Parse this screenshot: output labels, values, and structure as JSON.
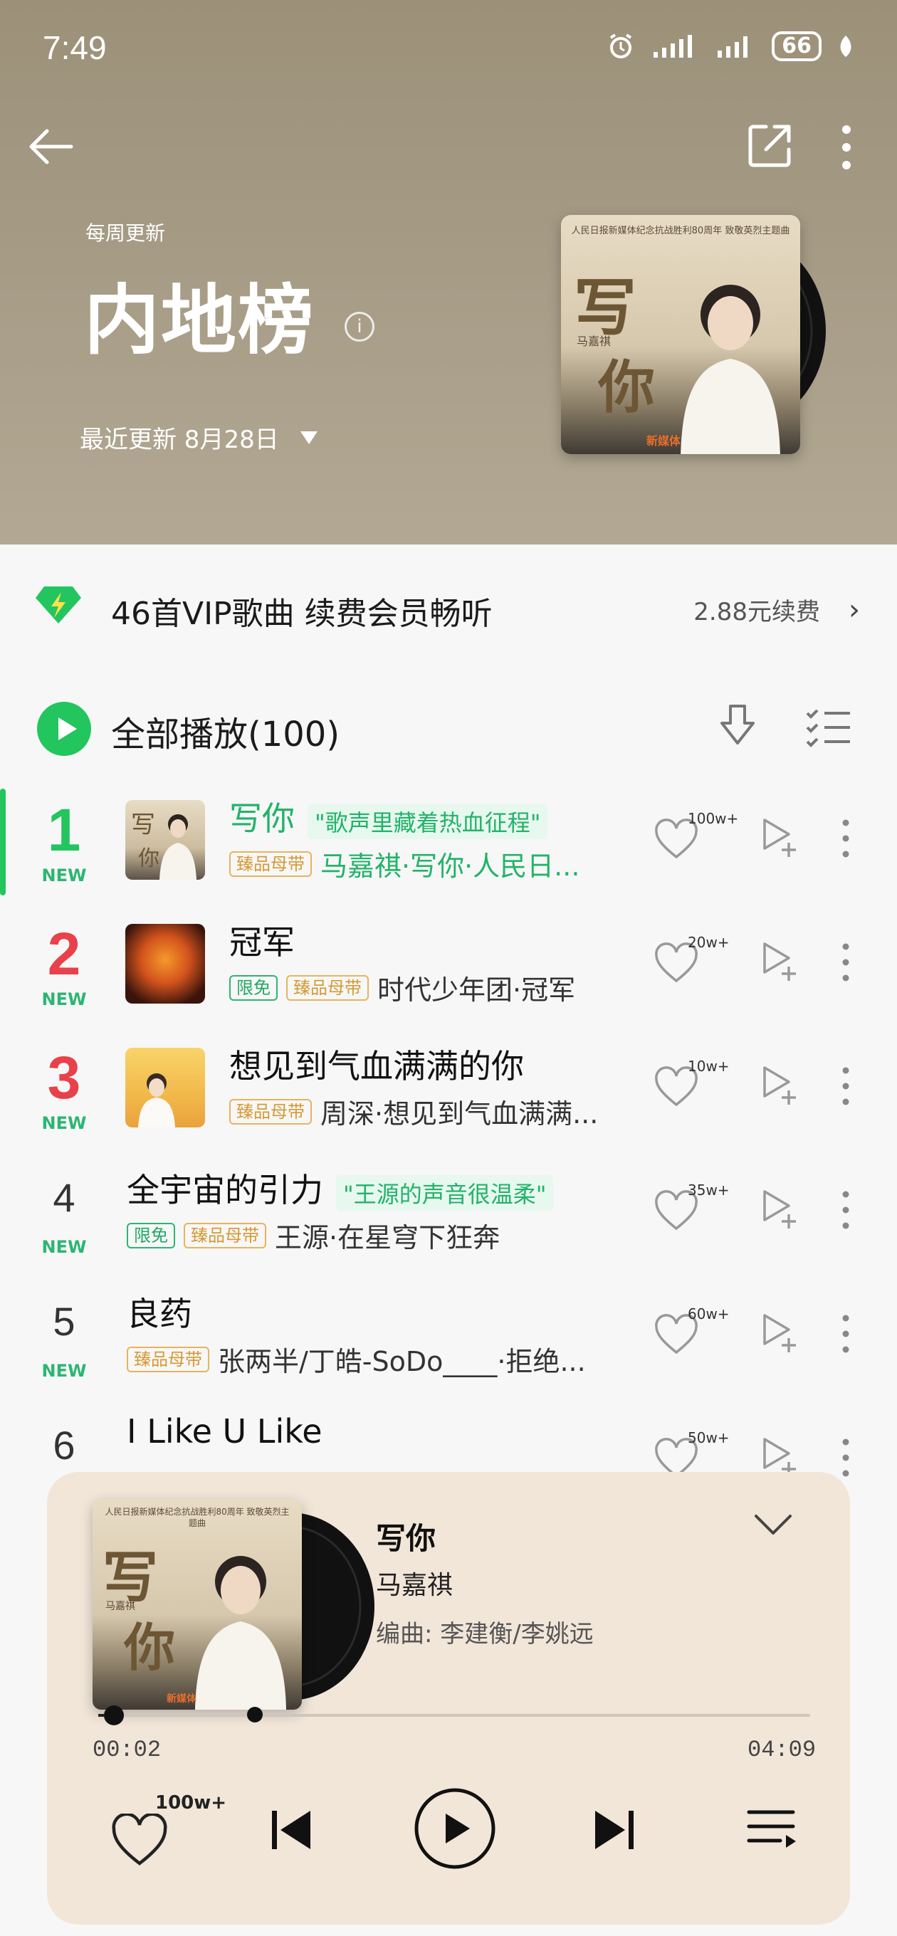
{
  "status": {
    "time": "7:49",
    "battery": "66"
  },
  "header": {
    "weekly": "每周更新",
    "title": "内地榜",
    "info": "i",
    "updated": "最近更新 8月28日",
    "cover": {
      "top_text": "人民日报新媒体纪念抗战胜利80周年 致敬英烈主题曲",
      "char1": "写",
      "char2": "你",
      "artist": "马嘉祺",
      "brand": "新媒体"
    }
  },
  "vip": {
    "text": "46首VIP歌曲 续费会员畅听",
    "renew": "2.88元续费",
    "chevron": "›"
  },
  "play_all": {
    "label": "全部播放(100)"
  },
  "songs": [
    {
      "rank": "1",
      "new": "NEW",
      "title": "写你",
      "tagline": "\"歌声里藏着热血征程\"",
      "badges": [
        "臻品母带"
      ],
      "meta": "马嘉祺·写你·人民日...",
      "likes": "100w+"
    },
    {
      "rank": "2",
      "new": "NEW",
      "title": "冠军",
      "badges": [
        "限免",
        "臻品母带"
      ],
      "meta": "时代少年团·冠军",
      "likes": "20w+"
    },
    {
      "rank": "3",
      "new": "NEW",
      "title": "想见到气血满满的你",
      "badges": [
        "臻品母带"
      ],
      "meta": "周深·想见到气血满满...",
      "likes": "10w+"
    },
    {
      "rank": "4",
      "new": "NEW",
      "title": "全宇宙的引力",
      "tagline": "\"王源的声音很温柔\"",
      "badges": [
        "限免",
        "臻品母带"
      ],
      "meta": "王源·在星穹下狂奔",
      "likes": "35w+"
    },
    {
      "rank": "5",
      "new": "NEW",
      "title": "良药",
      "badges": [
        "臻品母带"
      ],
      "meta": "张两半/丁皓-SoDo____·拒绝...",
      "likes": "60w+"
    },
    {
      "rank": "6",
      "title": "I Like U Like",
      "likes": "50w+"
    }
  ],
  "player": {
    "title": "写你",
    "artist": "马嘉祺",
    "credit": "编曲:  李建衡/李姚远",
    "current": "00:02",
    "duration": "04:09",
    "progress": 0.008,
    "marker": 0.22,
    "likes": "100w+"
  },
  "colors": {
    "accent": "#22c55e",
    "rank_red": "#e8414a",
    "header_bg": "#a49a84"
  }
}
